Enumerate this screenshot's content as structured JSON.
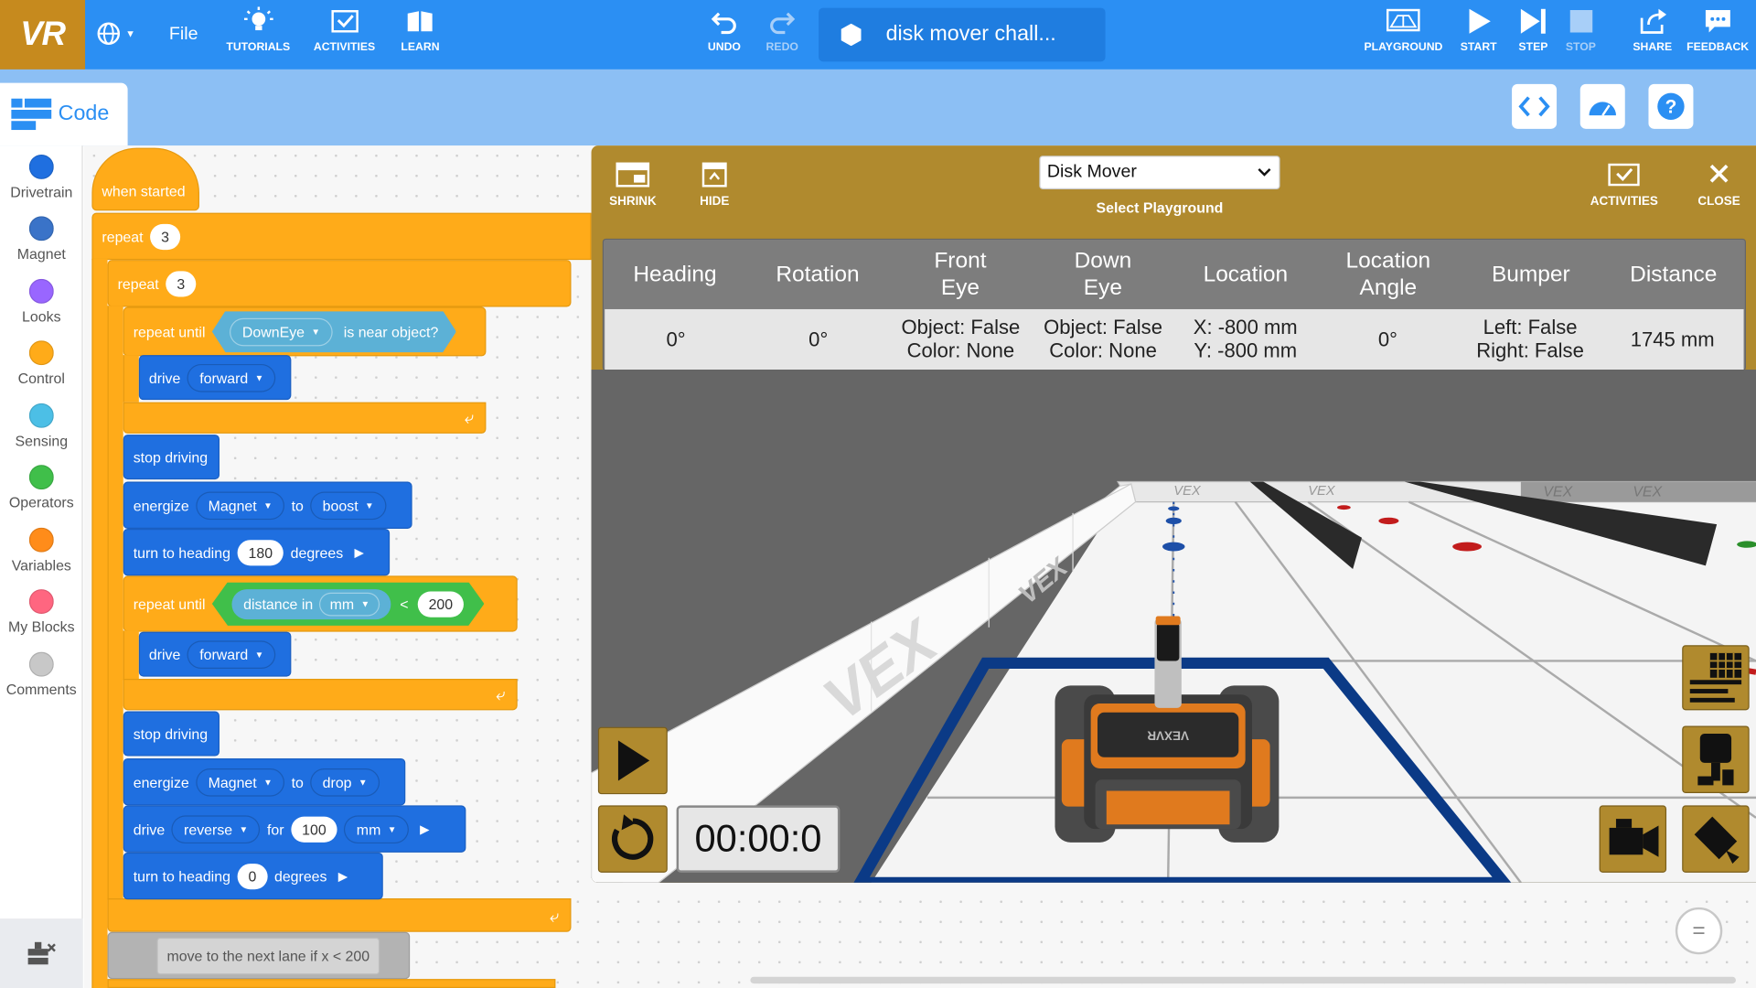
{
  "topbar": {
    "logo": "VR",
    "file_label": "File",
    "tutorials_label": "TUTORIALS",
    "activities_label": "ACTIVITIES",
    "learn_label": "LEARN",
    "undo_label": "UNDO",
    "redo_label": "REDO",
    "project_title": "disk mover chall...",
    "playground_label": "PLAYGROUND",
    "start_label": "START",
    "step_label": "STEP",
    "stop_label": "STOP",
    "share_label": "SHARE",
    "feedback_label": "FEEDBACK"
  },
  "code_tab": {
    "label": "Code"
  },
  "categories": [
    {
      "label": "Drivetrain",
      "color": "#1f6fe0"
    },
    {
      "label": "Magnet",
      "color": "#3a73c8"
    },
    {
      "label": "Looks",
      "color": "#9966ff"
    },
    {
      "label": "Control",
      "color": "#ffab19"
    },
    {
      "label": "Sensing",
      "color": "#4cbfe6"
    },
    {
      "label": "Operators",
      "color": "#40bf4a"
    },
    {
      "label": "Variables",
      "color": "#ff8c1a"
    },
    {
      "label": "My Blocks",
      "color": "#ff6680"
    },
    {
      "label": "Comments",
      "color": "#c8c8c8"
    }
  ],
  "blocks": {
    "when_started": "when started",
    "repeat_outer": "repeat",
    "repeat_outer_count": "3",
    "repeat_inner": "repeat",
    "repeat_inner_count": "3",
    "repeat_until_1": "repeat until",
    "downeye_sensor": "DownEye",
    "is_near_object": "is near object?",
    "drive_1": "drive",
    "forward_1": "forward",
    "stop_driving_1": "stop driving",
    "energize_1": "energize",
    "magnet_1": "Magnet",
    "to_1": "to",
    "boost": "boost",
    "turn_to_heading_1": "turn to heading",
    "heading_value_1": "180",
    "degrees_1": "degrees",
    "repeat_until_2": "repeat until",
    "distance_in": "distance in",
    "mm_unit_1": "mm",
    "less_than": "<",
    "distance_value": "200",
    "drive_2": "drive",
    "forward_2": "forward",
    "stop_driving_2": "stop driving",
    "energize_2": "energize",
    "magnet_2": "Magnet",
    "to_2": "to",
    "drop": "drop",
    "drive_3": "drive",
    "reverse": "reverse",
    "for_label": "for",
    "drive_distance": "100",
    "mm_unit_2": "mm",
    "turn_to_heading_2": "turn to heading",
    "heading_value_2": "0",
    "degrees_2": "degrees",
    "comment": "move to the next lane if x < 200"
  },
  "playground": {
    "shrink_label": "SHRINK",
    "hide_label": "HIDE",
    "selected_playground": "Disk Mover",
    "select_label": "Select Playground",
    "activities_label": "ACTIVITIES",
    "close_label": "CLOSE",
    "stats_headers": [
      "Heading",
      "Rotation",
      "Front\nEye",
      "Down\nEye",
      "Location",
      "Location\nAngle",
      "Bumper",
      "Distance"
    ],
    "stats_values": [
      "0°",
      "0°",
      "Object: False\nColor: None",
      "Object: False\nColor: None",
      "X: -800 mm\nY: -800 mm",
      "0°",
      "Left: False\nRight: False",
      "1745 mm"
    ],
    "timer": "00:00:0",
    "robot_label": "VEXVR",
    "wall_brand": "VEX"
  }
}
